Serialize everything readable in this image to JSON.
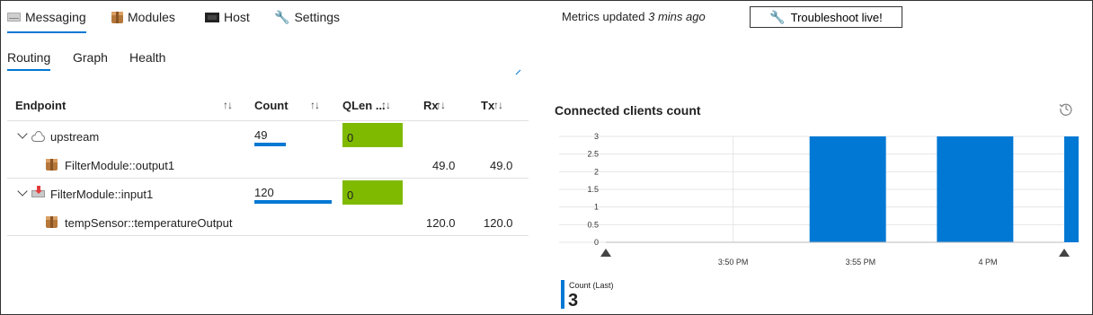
{
  "top_tabs": [
    {
      "label": "Messaging",
      "icon": "envelope-icon",
      "active": true
    },
    {
      "label": "Modules",
      "icon": "package-icon",
      "active": false
    },
    {
      "label": "Host",
      "icon": "computer-icon",
      "active": false
    },
    {
      "label": "Settings",
      "icon": "wrench-icon",
      "active": false
    }
  ],
  "metrics": {
    "prefix": "Metrics updated ",
    "value": "3 mins ago"
  },
  "troubleshoot": {
    "label": "Troubleshoot live!"
  },
  "sub_tabs": [
    {
      "label": "Routing",
      "active": true
    },
    {
      "label": "Graph",
      "active": false
    },
    {
      "label": "Health",
      "active": false
    }
  ],
  "table": {
    "headers": {
      "endpoint": "Endpoint",
      "count": "Count",
      "qlen": "QLen ...",
      "rx": "Rx",
      "tx": "Tx"
    },
    "sort_glyph": "↑↓",
    "rows": [
      {
        "name": "upstream",
        "count": "49",
        "count_fraction": 0.41,
        "qlen": "0",
        "rx": "",
        "tx": ""
      },
      {
        "name": "FilterModule::output1",
        "count": "",
        "qlen": "",
        "rx": "49.0",
        "tx": "49.0"
      },
      {
        "name": "FilterModule::input1",
        "count": "120",
        "count_fraction": 1.0,
        "qlen": "0",
        "rx": "",
        "tx": ""
      },
      {
        "name": "tempSensor::temperatureOutput",
        "count": "",
        "qlen": "",
        "rx": "120.0",
        "tx": "120.0"
      }
    ]
  },
  "chart_data": {
    "type": "bar",
    "title": "Connected clients count",
    "series": [
      {
        "name": "Count (Last)",
        "color": "#0078d4"
      }
    ],
    "bars": [
      {
        "start": "3:53",
        "end": "3:56",
        "value": 3
      },
      {
        "start": "3:58",
        "end": "4:01",
        "value": 3
      },
      {
        "start": "4:03",
        "end": "4:06",
        "value": 3
      }
    ],
    "x_ticks": [
      "3:50 PM",
      "3:55 PM",
      "4 PM"
    ],
    "x_tick_minutes": [
      230,
      235,
      240
    ],
    "x_range_minutes": [
      225,
      243
    ],
    "y_ticks": [
      "0",
      "0.5",
      "1",
      "1.5",
      "2",
      "2.5",
      "3"
    ],
    "ylim": [
      0,
      3
    ],
    "grid": true
  },
  "legend": {
    "name": "Count (Last)",
    "value": "3"
  },
  "colors": {
    "accent": "#0078d4",
    "qlen_ok": "#7fba00"
  }
}
